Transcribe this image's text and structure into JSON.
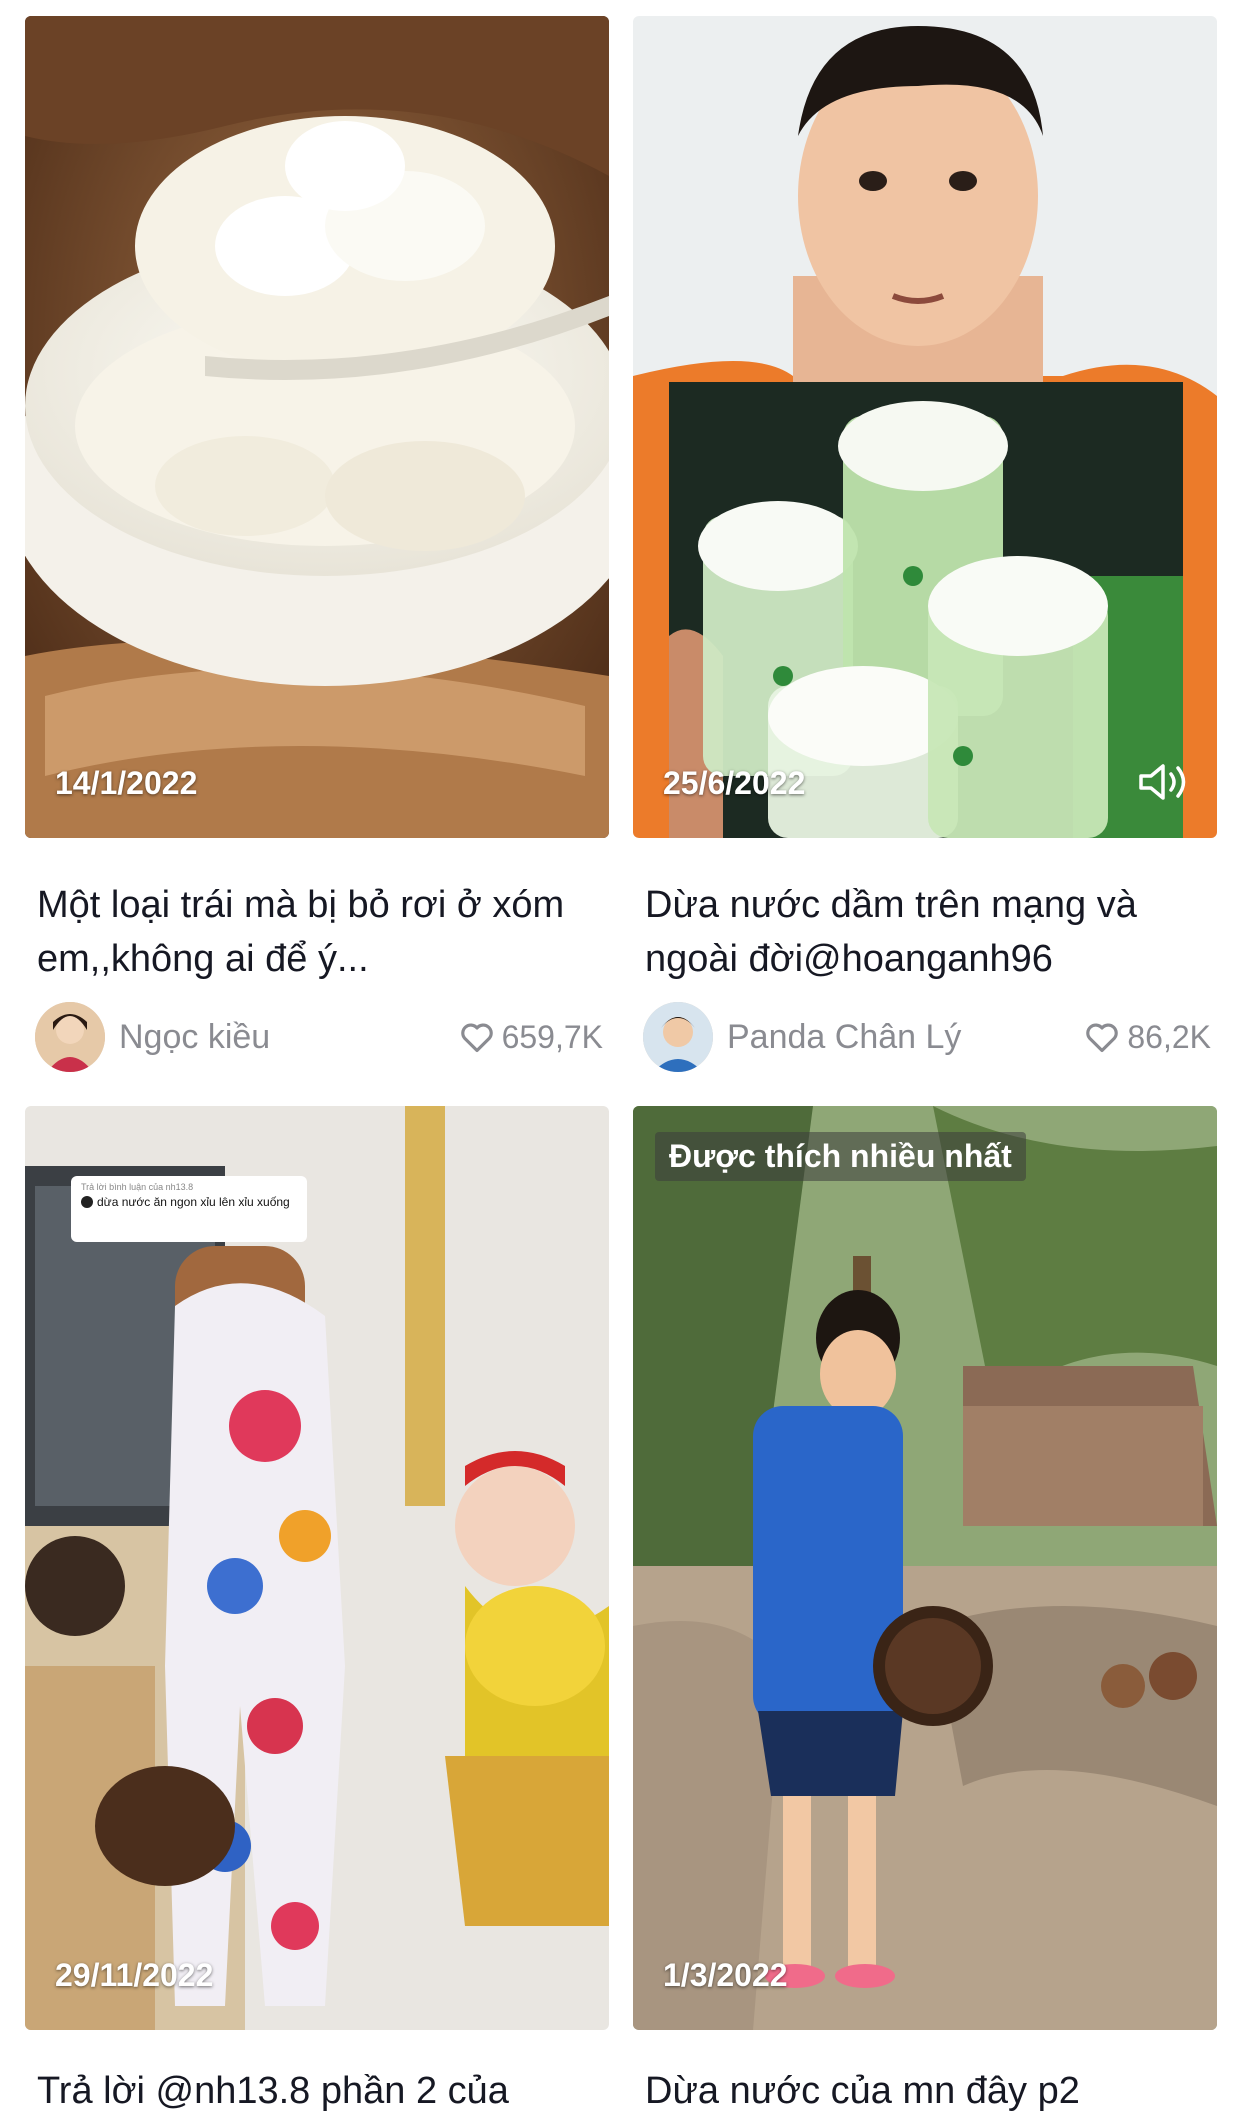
{
  "videos": [
    {
      "date": "14/1/2022",
      "caption": "Một loại trái mà bị bỏ rơi ở xóm em,,không ai để ý...",
      "author": "Ngọc kiều",
      "likes": "659,7K"
    },
    {
      "date": "25/6/2022",
      "caption": "Dừa nước dầm trên mạng và ngoài đời@hoanganh96",
      "author": "Panda Chân Lý",
      "likes": "86,2K",
      "sound_icon": "speaker-wave-icon"
    },
    {
      "date": "29/11/2022",
      "caption": "Trả lời @nh13.8 phần 2 của",
      "reply_overlay": {
        "header": "Trả lời bình luận của nh13.8",
        "text": "dừa nước ăn ngon xỉu lên xỉu xuống"
      }
    },
    {
      "date": "1/3/2022",
      "caption": "Dừa nước của mn đây p2",
      "badge": "Được thích nhiều nhất"
    }
  ],
  "icons": {
    "like": "heart-outline-icon",
    "sound": "speaker-wave-icon"
  },
  "colors": {
    "caption_text": "#161823",
    "meta_text": "#8a8b91",
    "background": "#ffffff"
  }
}
